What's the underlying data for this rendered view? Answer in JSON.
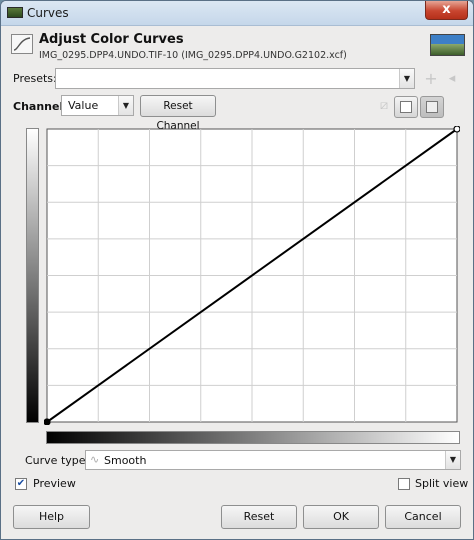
{
  "window": {
    "title": "Curves",
    "close_label": "x"
  },
  "header": {
    "title": "Adjust Color Curves",
    "subtitle": "IMG_0295.DPP4.UNDO.TIF-10 (IMG_0295.DPP4.UNDO.G2102.xcf)"
  },
  "presets": {
    "label": "Presets:",
    "value": ""
  },
  "channel": {
    "label": "Channel:",
    "value": "Value",
    "reset_label": "Reset Channel"
  },
  "curve_type": {
    "label": "Curve type:",
    "value": "Smooth"
  },
  "preview": {
    "label": "Preview",
    "checked": true
  },
  "split_view": {
    "label": "Split view",
    "checked": false
  },
  "buttons": {
    "help": "Help",
    "reset": "Reset",
    "ok": "OK",
    "cancel": "Cancel"
  },
  "curve": {
    "points": [
      [
        0,
        0
      ],
      [
        255,
        255
      ]
    ],
    "grid_divisions": 8,
    "range": [
      0,
      255
    ]
  }
}
